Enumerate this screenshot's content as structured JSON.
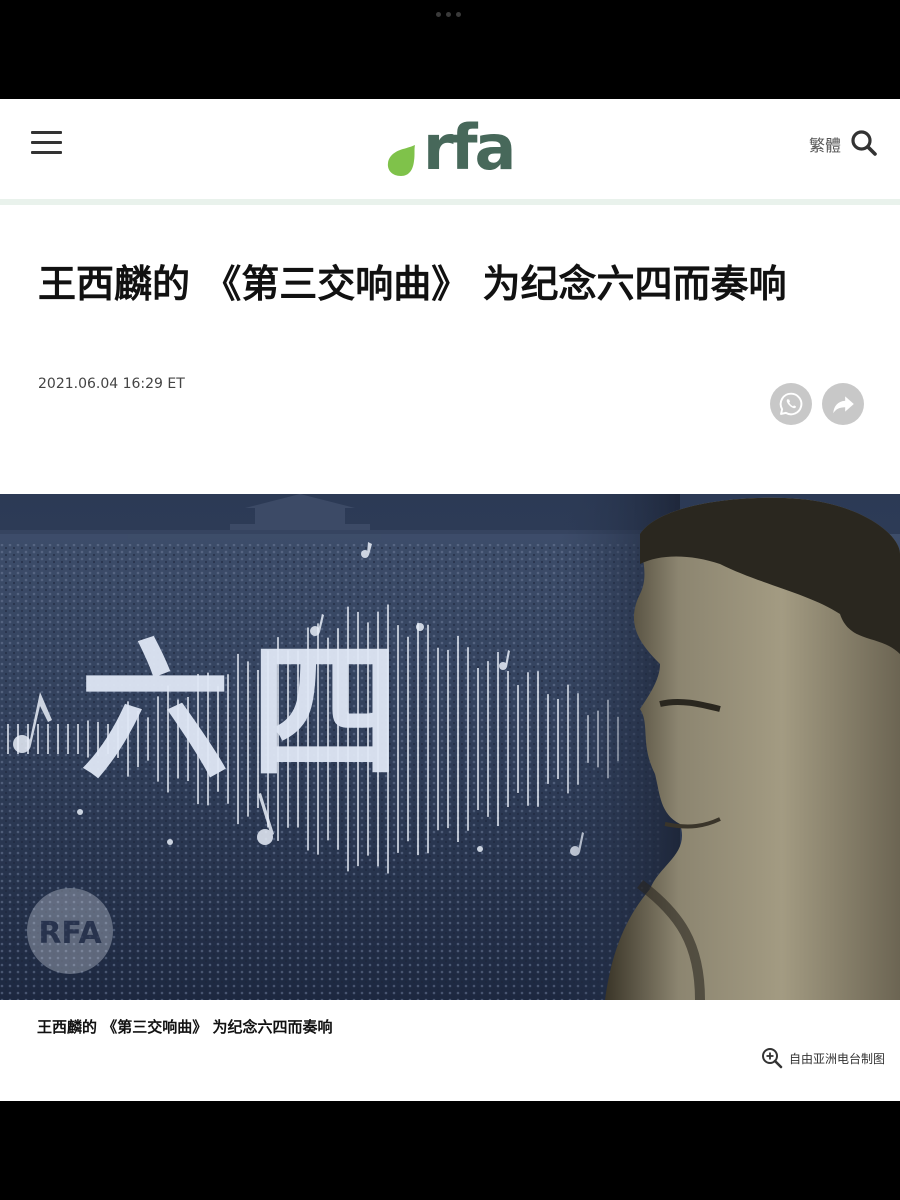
{
  "colors": {
    "brand_green": "#47685a",
    "brand_dot": "#7fc24a",
    "header_rule": "#e9f2ec",
    "share_gray": "#c8c8c8"
  },
  "header": {
    "menu_icon": "hamburger-menu-icon",
    "logo_text": "rfa",
    "language_toggle": "繁體",
    "search_icon": "search-icon"
  },
  "article": {
    "title": "王西麟的 《第三交响曲》 为纪念六四而奏响",
    "date": "2021.06.04 16:29 ET",
    "share": {
      "whatsapp_icon": "whatsapp-icon",
      "forward_icon": "share-forward-icon"
    }
  },
  "hero": {
    "overlay_text": "六四",
    "watermark": "RFA"
  },
  "caption": {
    "text": "王西麟的 《第三交响曲》 为纪念六四而奏响",
    "credit": "自由亚洲电台制图",
    "zoom_icon": "zoom-in-icon"
  }
}
